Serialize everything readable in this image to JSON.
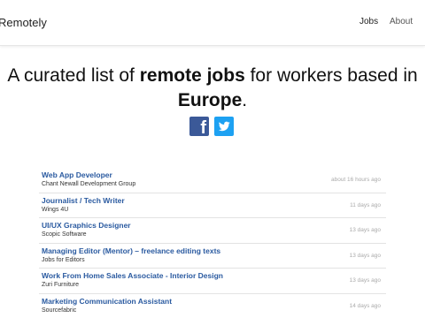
{
  "nav": {
    "brand": "Remotely",
    "links": [
      "Jobs",
      "About"
    ]
  },
  "hero": {
    "text_1": "A curated list of ",
    "bold_1": "remote jobs",
    "text_2": " for workers based in ",
    "bold_2": "Europe",
    "text_3": "."
  },
  "social": {
    "facebook_icon": "facebook-icon",
    "twitter_icon": "twitter-icon",
    "facebook_color": "#3b5998",
    "twitter_color": "#1da1f2"
  },
  "jobs": [
    {
      "title": "Web App Developer",
      "company": "Chant Newall Development Group",
      "time": "about 16 hours ago"
    },
    {
      "title": "Journalist / Tech Writer",
      "company": "Wings 4U",
      "time": "11 days ago"
    },
    {
      "title": "UI/UX Graphics Designer",
      "company": "Scopic Software",
      "time": "13 days ago"
    },
    {
      "title": "Managing Editor (Mentor) – freelance editing texts",
      "company": "Jobs for Editors",
      "time": "13 days ago"
    },
    {
      "title": "Work From Home Sales Associate - Interior Design",
      "company": "Zuri Furniture",
      "time": "13 days ago"
    },
    {
      "title": "Marketing Communication Assistant",
      "company": "Sourcefabric",
      "time": "14 days ago"
    }
  ]
}
